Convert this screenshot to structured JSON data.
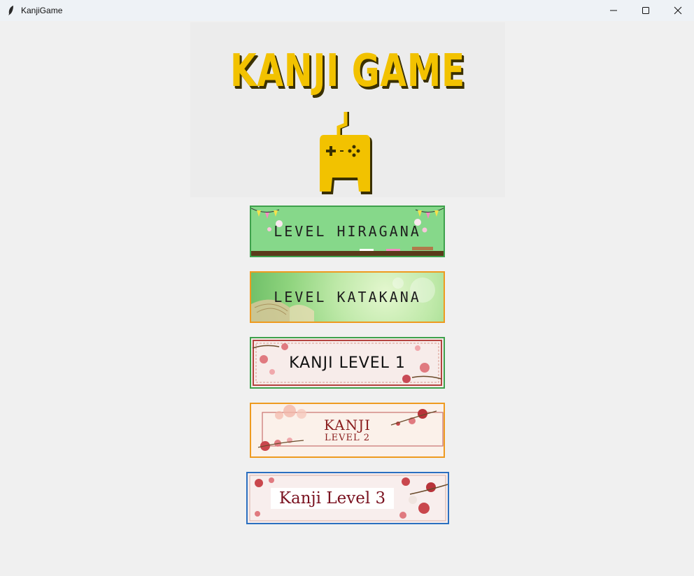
{
  "window": {
    "title": "KanjiGame",
    "controls": [
      "minimize",
      "maximize",
      "close"
    ]
  },
  "banner": {
    "logo_text": "KANJI GAME",
    "logo_color": "#f2c200",
    "icon": "gamepad-icon"
  },
  "levels": [
    {
      "label": "LEVEL HIRAGANA",
      "border_color": "#3ea14c"
    },
    {
      "label": "LEVEL KATAKANA",
      "border_color": "#ee9a1f"
    },
    {
      "label": "KANJI LEVEL 1",
      "border_color": "#3ea14c"
    },
    {
      "label_line1": "KANJI",
      "label_line2": "LEVEL 2",
      "border_color": "#ee9a1f"
    },
    {
      "label": "Kanji Level 3",
      "border_color": "#2b6fc0"
    }
  ]
}
